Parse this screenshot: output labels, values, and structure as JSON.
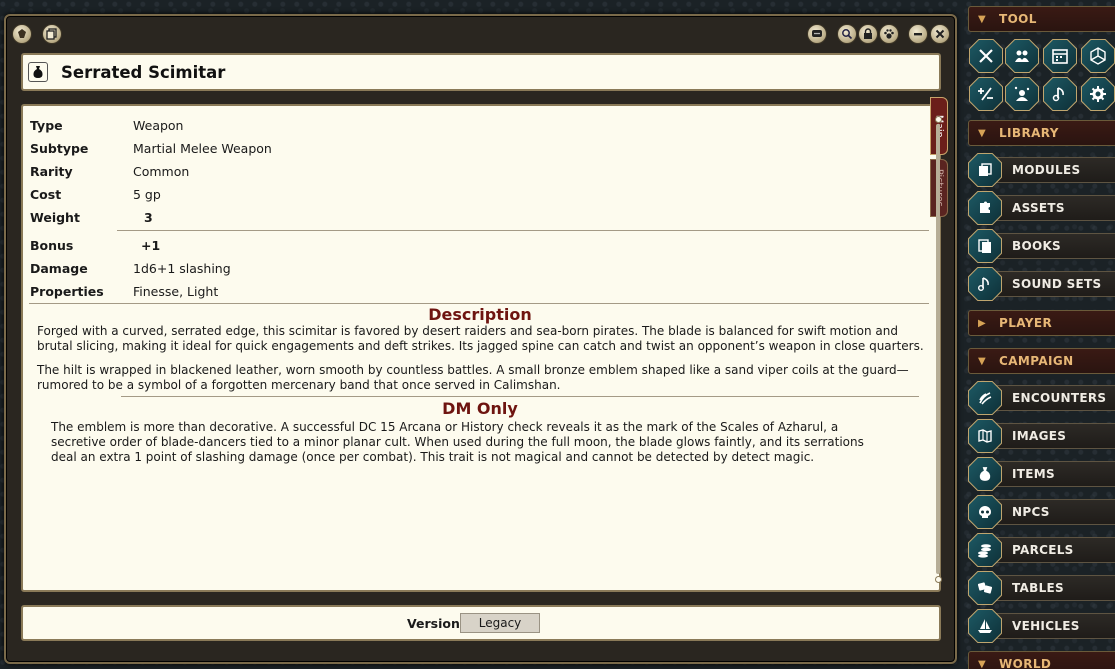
{
  "window": {
    "controls": {
      "share": "share-icon",
      "lock": "lock-icon",
      "identify": "paw-icon",
      "minimize": "minimize-icon",
      "close": "close-icon"
    }
  },
  "record": {
    "name": "Serrated Scimitar",
    "type_icon": "item-bag-icon"
  },
  "fields": {
    "type": {
      "label": "Type",
      "value": "Weapon"
    },
    "subtype": {
      "label": "Subtype",
      "value": "Martial Melee Weapon"
    },
    "rarity": {
      "label": "Rarity",
      "value": "Common"
    },
    "cost": {
      "label": "Cost",
      "value": "5 gp"
    },
    "weight": {
      "label": "Weight",
      "value": "3"
    },
    "bonus": {
      "label": "Bonus",
      "value": "+1"
    },
    "damage": {
      "label": "Damage",
      "value": "1d6+1 slashing"
    },
    "properties": {
      "label": "Properties",
      "value": "Finesse, Light"
    }
  },
  "description": {
    "title": "Description",
    "p1": "Forged with a curved, serrated edge, this scimitar is favored by desert raiders and sea-born pirates. The blade is balanced for swift motion and brutal slicing, making it ideal for quick engagements and deft strikes. Its jagged spine can catch and twist an opponent’s weapon in close quarters.",
    "p2": "The hilt is wrapped in blackened leather, worn smooth by countless battles. A small bronze emblem shaped like a sand viper coils at the guard—rumored to be a symbol of a forgotten mercenary band that once served in Calimshan."
  },
  "dm_only": {
    "title": "DM Only",
    "p1": "The emblem is more than decorative. A successful DC 15 Arcana or History check reveals it as the mark of the Scales of Azharul, a secretive order of blade-dancers tied to a minor planar cult. When used during the full moon, the blade glows faintly, and its serrations deal an extra 1 point of slashing damage (once per combat). This trait is not magical and cannot be detected by detect magic."
  },
  "tabs": {
    "main": "Main",
    "pictures": "Pictures"
  },
  "footer": {
    "version_label": "Version",
    "version_value": "Legacy"
  },
  "sidebar": {
    "tool": {
      "label": "TOOL",
      "arrow": "▼"
    },
    "library": {
      "label": "LIBRARY",
      "arrow": "▼"
    },
    "player": {
      "label": "PLAYER",
      "arrow": "▶"
    },
    "campaign": {
      "label": "CAMPAIGN",
      "arrow": "▼"
    },
    "world": {
      "label": "WORLD",
      "arrow": "▼"
    },
    "tool_icons": [
      "crossed-swords-icon",
      "party-icon",
      "calendar-icon",
      "dice-icon",
      "modifiers-icon",
      "effects-icon",
      "music-icon",
      "gear-icon"
    ],
    "library_items": [
      "MODULES",
      "ASSETS",
      "BOOKS",
      "SOUND SETS"
    ],
    "campaign_items": [
      "ENCOUNTERS",
      "IMAGES",
      "ITEMS",
      "NPCS",
      "PARCELS",
      "TABLES",
      "VEHICLES"
    ],
    "colors": {
      "accent": "#6e1410",
      "sidebar_text": "#e7b776",
      "tool_button": "#1d5964"
    }
  }
}
